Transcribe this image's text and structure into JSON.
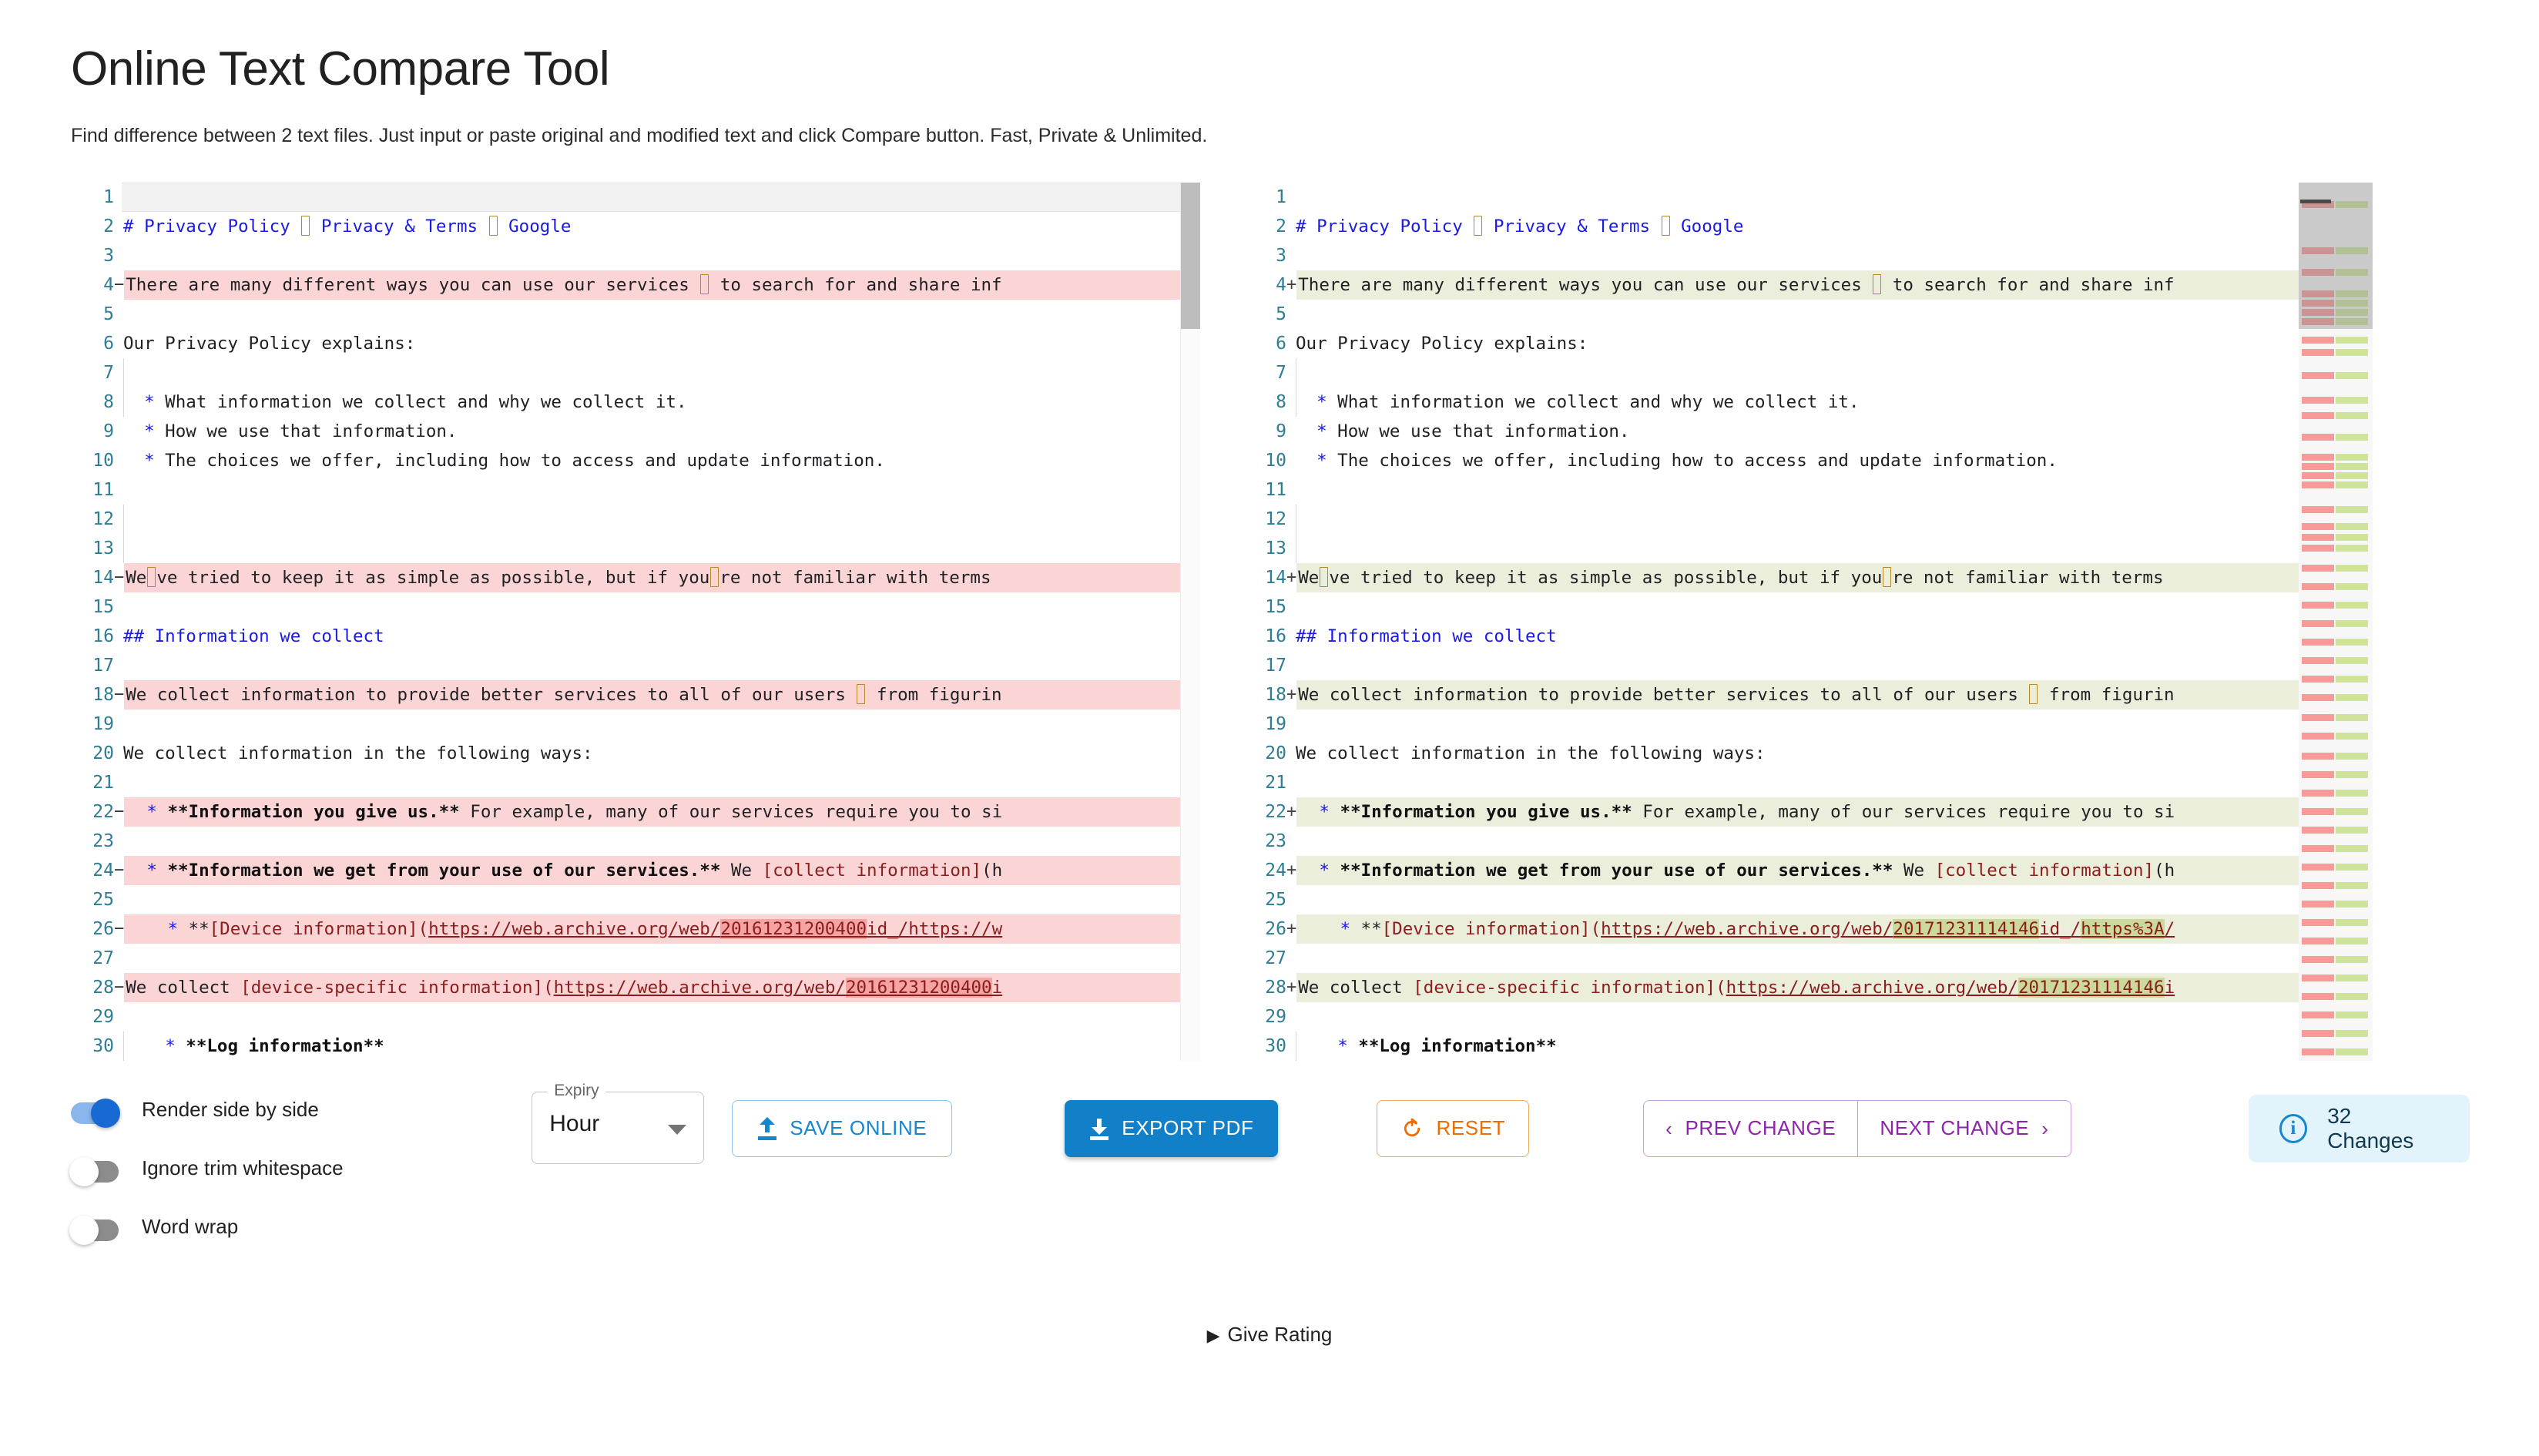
{
  "header": {
    "title": "Online Text Compare Tool",
    "subtitle": "Find difference between 2 text files. Just input or paste original and modified text and click Compare button. Fast, Private & Unlimited."
  },
  "diff": {
    "left_lines": [
      {
        "n": "1",
        "marker": "",
        "state": "active",
        "text": ""
      },
      {
        "n": "2",
        "marker": "",
        "state": "ctx",
        "text": "# Privacy Policy – Privacy & Terms – Google"
      },
      {
        "n": "3",
        "marker": "",
        "state": "ctx",
        "text": ""
      },
      {
        "n": "4",
        "marker": "−",
        "state": "del",
        "text": "There are many different ways you can use our services – to search for and share inf"
      },
      {
        "n": "5",
        "marker": "",
        "state": "ctx",
        "text": ""
      },
      {
        "n": "6",
        "marker": "",
        "state": "ctx",
        "text": "Our Privacy Policy explains:"
      },
      {
        "n": "7",
        "marker": "",
        "state": "ctx",
        "text": ""
      },
      {
        "n": "8",
        "marker": "",
        "state": "ctx",
        "text": "  * What information we collect and why we collect it."
      },
      {
        "n": "9",
        "marker": "",
        "state": "ctx",
        "text": "  * How we use that information."
      },
      {
        "n": "10",
        "marker": "",
        "state": "ctx",
        "text": "  * The choices we offer, including how to access and update information."
      },
      {
        "n": "11",
        "marker": "",
        "state": "ctx",
        "text": ""
      },
      {
        "n": "12",
        "marker": "",
        "state": "ctx",
        "text": ""
      },
      {
        "n": "13",
        "marker": "",
        "state": "ctx",
        "text": ""
      },
      {
        "n": "14",
        "marker": "−",
        "state": "del",
        "text": "We’ve tried to keep it as simple as possible, but if you’re not familiar with terms"
      },
      {
        "n": "15",
        "marker": "",
        "state": "ctx",
        "text": ""
      },
      {
        "n": "16",
        "marker": "",
        "state": "ctx",
        "text": "## Information we collect"
      },
      {
        "n": "17",
        "marker": "",
        "state": "ctx",
        "text": ""
      },
      {
        "n": "18",
        "marker": "−",
        "state": "del",
        "text": "We collect information to provide better services to all of our users – from figurin"
      },
      {
        "n": "19",
        "marker": "",
        "state": "ctx",
        "text": ""
      },
      {
        "n": "20",
        "marker": "",
        "state": "ctx",
        "text": "We collect information in the following ways:"
      },
      {
        "n": "21",
        "marker": "",
        "state": "ctx",
        "text": ""
      },
      {
        "n": "22",
        "marker": "−",
        "state": "del",
        "text": "  * **Information you give us.** For example, many of our services require you to si"
      },
      {
        "n": "23",
        "marker": "",
        "state": "ctx",
        "text": ""
      },
      {
        "n": "24",
        "marker": "−",
        "state": "del",
        "text": "  * **Information we get from your use of our services.** We [collect information](h"
      },
      {
        "n": "25",
        "marker": "",
        "state": "ctx",
        "text": ""
      },
      {
        "n": "26",
        "marker": "−",
        "state": "del",
        "text": "    * **[Device information](https://web.archive.org/web/20161231200400id_/https://w"
      },
      {
        "n": "27",
        "marker": "",
        "state": "ctx",
        "text": ""
      },
      {
        "n": "28",
        "marker": "−",
        "state": "del",
        "text": "We collect [device-specific information](https://web.archive.org/web/20161231200400i"
      },
      {
        "n": "29",
        "marker": "",
        "state": "ctx",
        "text": ""
      },
      {
        "n": "30",
        "marker": "",
        "state": "ctx",
        "text": "    * **Log information**"
      }
    ],
    "right_lines": [
      {
        "n": "1",
        "marker": "",
        "state": "ctx",
        "text": ""
      },
      {
        "n": "2",
        "marker": "",
        "state": "ctx",
        "text": "# Privacy Policy – Privacy & Terms – Google"
      },
      {
        "n": "3",
        "marker": "",
        "state": "ctx",
        "text": ""
      },
      {
        "n": "4",
        "marker": "+",
        "state": "add",
        "text": "There are many different ways you can use our services – to search for and share inf"
      },
      {
        "n": "5",
        "marker": "",
        "state": "ctx",
        "text": ""
      },
      {
        "n": "6",
        "marker": "",
        "state": "ctx",
        "text": "Our Privacy Policy explains:"
      },
      {
        "n": "7",
        "marker": "",
        "state": "ctx",
        "text": ""
      },
      {
        "n": "8",
        "marker": "",
        "state": "ctx",
        "text": "  * What information we collect and why we collect it."
      },
      {
        "n": "9",
        "marker": "",
        "state": "ctx",
        "text": "  * How we use that information."
      },
      {
        "n": "10",
        "marker": "",
        "state": "ctx",
        "text": "  * The choices we offer, including how to access and update information."
      },
      {
        "n": "11",
        "marker": "",
        "state": "ctx",
        "text": ""
      },
      {
        "n": "12",
        "marker": "",
        "state": "ctx",
        "text": ""
      },
      {
        "n": "13",
        "marker": "",
        "state": "ctx",
        "text": ""
      },
      {
        "n": "14",
        "marker": "+",
        "state": "add",
        "text": "We’ve tried to keep it as simple as possible, but if you’re not familiar with terms"
      },
      {
        "n": "15",
        "marker": "",
        "state": "ctx",
        "text": ""
      },
      {
        "n": "16",
        "marker": "",
        "state": "ctx",
        "text": "## Information we collect"
      },
      {
        "n": "17",
        "marker": "",
        "state": "ctx",
        "text": ""
      },
      {
        "n": "18",
        "marker": "+",
        "state": "add",
        "text": "We collect information to provide better services to all of our users – from figurin"
      },
      {
        "n": "19",
        "marker": "",
        "state": "ctx",
        "text": ""
      },
      {
        "n": "20",
        "marker": "",
        "state": "ctx",
        "text": "We collect information in the following ways:"
      },
      {
        "n": "21",
        "marker": "",
        "state": "ctx",
        "text": ""
      },
      {
        "n": "22",
        "marker": "+",
        "state": "add",
        "text": "  * **Information you give us.** For example, many of our services require you to si"
      },
      {
        "n": "23",
        "marker": "",
        "state": "ctx",
        "text": ""
      },
      {
        "n": "24",
        "marker": "+",
        "state": "add",
        "text": "  * **Information we get from your use of our services.** We [collect information](h"
      },
      {
        "n": "25",
        "marker": "",
        "state": "ctx",
        "text": ""
      },
      {
        "n": "26",
        "marker": "+",
        "state": "add",
        "text": "    * **[Device information](https://web.archive.org/web/20171231114146id_/https%3A/"
      },
      {
        "n": "27",
        "marker": "",
        "state": "ctx",
        "text": ""
      },
      {
        "n": "28",
        "marker": "+",
        "state": "add",
        "text": "We collect [device-specific information](https://web.archive.org/web/20171231114146i"
      },
      {
        "n": "29",
        "marker": "",
        "state": "ctx",
        "text": ""
      },
      {
        "n": "30",
        "marker": "",
        "state": "ctx",
        "text": "    * **Log information**"
      }
    ]
  },
  "toolbar": {
    "toggles": [
      {
        "label": "Render side by side",
        "on": true
      },
      {
        "label": "Ignore trim whitespace",
        "on": false
      },
      {
        "label": "Word wrap",
        "on": false
      }
    ],
    "expiry": {
      "legend": "Expiry",
      "value": "Hour"
    },
    "save_label": "SAVE ONLINE",
    "export_label": "EXPORT PDF",
    "reset_label": "RESET",
    "prev_change_label": "PREV CHANGE",
    "next_change_label": "NEXT CHANGE",
    "prev_chevron": "‹",
    "next_chevron": "›",
    "changes_label": "32 Changes",
    "info_glyph": "i"
  },
  "footer": {
    "triangle": "▶",
    "rating_label": "Give Rating"
  },
  "colors": {
    "accent_blue": "#1180c8",
    "delete_bg": "#fbd5d5",
    "add_bg": "#eaeedb",
    "delete_word": "#f6a3a3",
    "add_word": "#cbd99a",
    "reset_orange": "#ef6c00",
    "change_purple": "#8e24aa",
    "gutter_teal": "#2f7d95",
    "badge_bg": "#e3f3fc"
  }
}
